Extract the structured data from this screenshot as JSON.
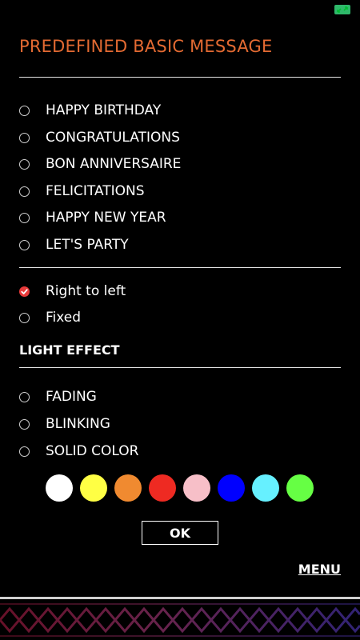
{
  "header": {
    "title": "PREDEFINED BASIC MESSAGE",
    "expand_icon": "expand-arrows-icon"
  },
  "messages": {
    "options": [
      {
        "label": "HAPPY BIRTHDAY",
        "selected": false
      },
      {
        "label": "CONGRATULATIONS",
        "selected": false
      },
      {
        "label": "BON ANNIVERSAIRE",
        "selected": false
      },
      {
        "label": "FELICITATIONS",
        "selected": false
      },
      {
        "label": "HAPPY NEW YEAR",
        "selected": false
      },
      {
        "label": "LET'S PARTY",
        "selected": false
      }
    ]
  },
  "scroll": {
    "options": [
      {
        "label": "Right to left",
        "selected": true
      },
      {
        "label": "Fixed",
        "selected": false
      }
    ]
  },
  "light_effect": {
    "title": "LIGHT EFFECT",
    "options": [
      {
        "label": "FADING",
        "selected": false
      },
      {
        "label": "BLINKING",
        "selected": false
      },
      {
        "label": "SOLID COLOR",
        "selected": false
      }
    ],
    "colors": [
      "#ffffff",
      "#ffff44",
      "#f08a30",
      "#ee2a22",
      "#f7bfc8",
      "#0000ff",
      "#66f0ff",
      "#66ff44"
    ]
  },
  "actions": {
    "ok_label": "OK",
    "menu_label": "MENU"
  },
  "theme": {
    "accent": "#e36a32",
    "selected": "#e83a3a",
    "background": "#000000"
  }
}
